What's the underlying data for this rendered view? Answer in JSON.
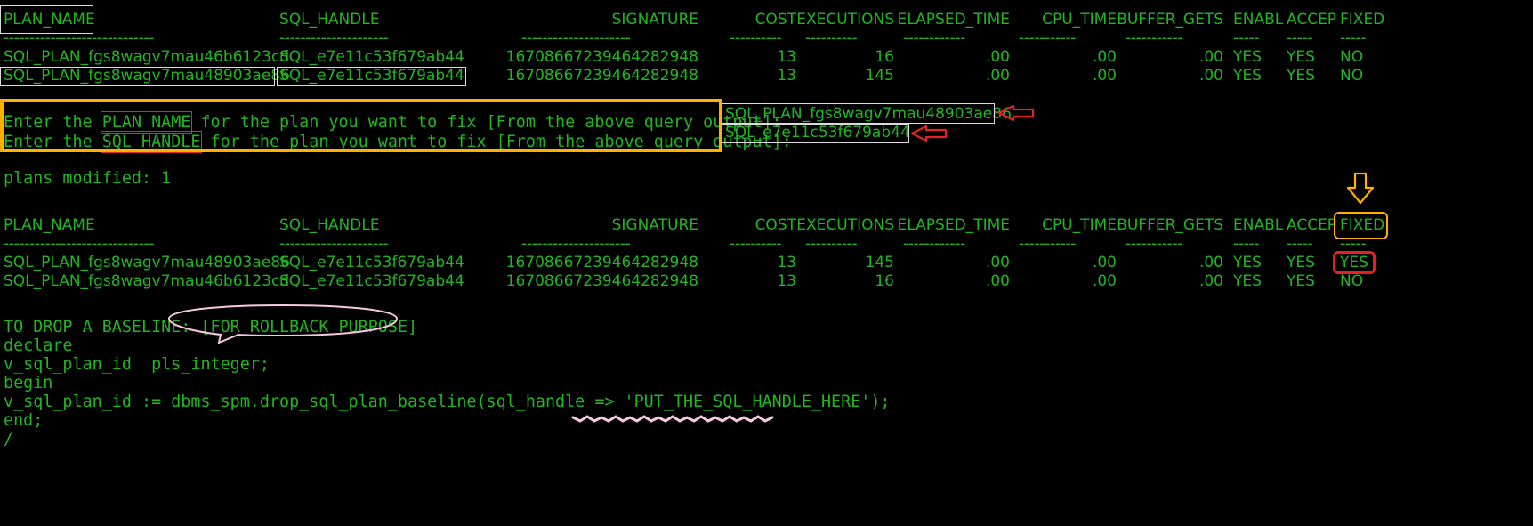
{
  "columns": [
    "PLAN_NAME",
    "SQL_HANDLE",
    "SIGNATURE",
    "COST",
    "EXECUTIONS",
    "ELAPSED_TIME",
    "CPU_TIME",
    "BUFFER_GETS",
    "ENABL",
    "ACCEP",
    "FIXED"
  ],
  "table1": {
    "rows": [
      [
        "SQL_PLAN_fgs8wagv7mau46b6123cd",
        "SQL_e7e11c53f679ab44",
        "16708667239464282948",
        "13",
        "16",
        ".00",
        ".00",
        ".00",
        "YES",
        "YES",
        "NO"
      ],
      [
        "SQL_PLAN_fgs8wagv7mau48903ae86",
        "SQL_e7e11c53f679ab44",
        "16708667239464282948",
        "13",
        "145",
        ".00",
        ".00",
        ".00",
        "YES",
        "YES",
        "NO"
      ]
    ]
  },
  "prompt1": {
    "prefix": "Enter the ",
    "keyword": "PLAN_NAME",
    "suffix": " for the plan you want to fix [From the above query output]:",
    "value": "SQL_PLAN_fgs8wagv7mau48903ae86"
  },
  "prompt2": {
    "prefix": "Enter the ",
    "keyword": "SQL_HANDLE",
    "suffix": " for the plan you want to fix [From the above query output]:",
    "value": "SQL_e7e11c53f679ab44"
  },
  "status_line": "plans modified: 1",
  "table2": {
    "rows": [
      [
        "SQL_PLAN_fgs8wagv7mau48903ae86",
        "SQL_e7e11c53f679ab44",
        "16708667239464282948",
        "13",
        "145",
        ".00",
        ".00",
        ".00",
        "YES",
        "YES",
        "YES"
      ],
      [
        "SQL_PLAN_fgs8wagv7mau46b6123cd",
        "SQL_e7e11c53f679ab44",
        "16708667239464282948",
        "13",
        "16",
        ".00",
        ".00",
        ".00",
        "YES",
        "YES",
        "NO"
      ]
    ]
  },
  "drop_heading": "TO DROP A BASELINE:",
  "drop_note": "[FOR ROLLBACK PURPOSE]",
  "code_lines": [
    "declare",
    "v_sql_plan_id  pls_integer;",
    "begin",
    "v_sql_plan_id := dbms_spm.drop_sql_plan_baseline(sql_handle => 'PUT_THE_SQL_HANDLE_HERE');",
    "end;",
    "/"
  ],
  "colors": {
    "terminal_bg": "#000000",
    "terminal_text": "#22b522",
    "callout_orange": "#ffb000",
    "callout_red": "#e52222",
    "callout_pink": "#f5c8df"
  }
}
